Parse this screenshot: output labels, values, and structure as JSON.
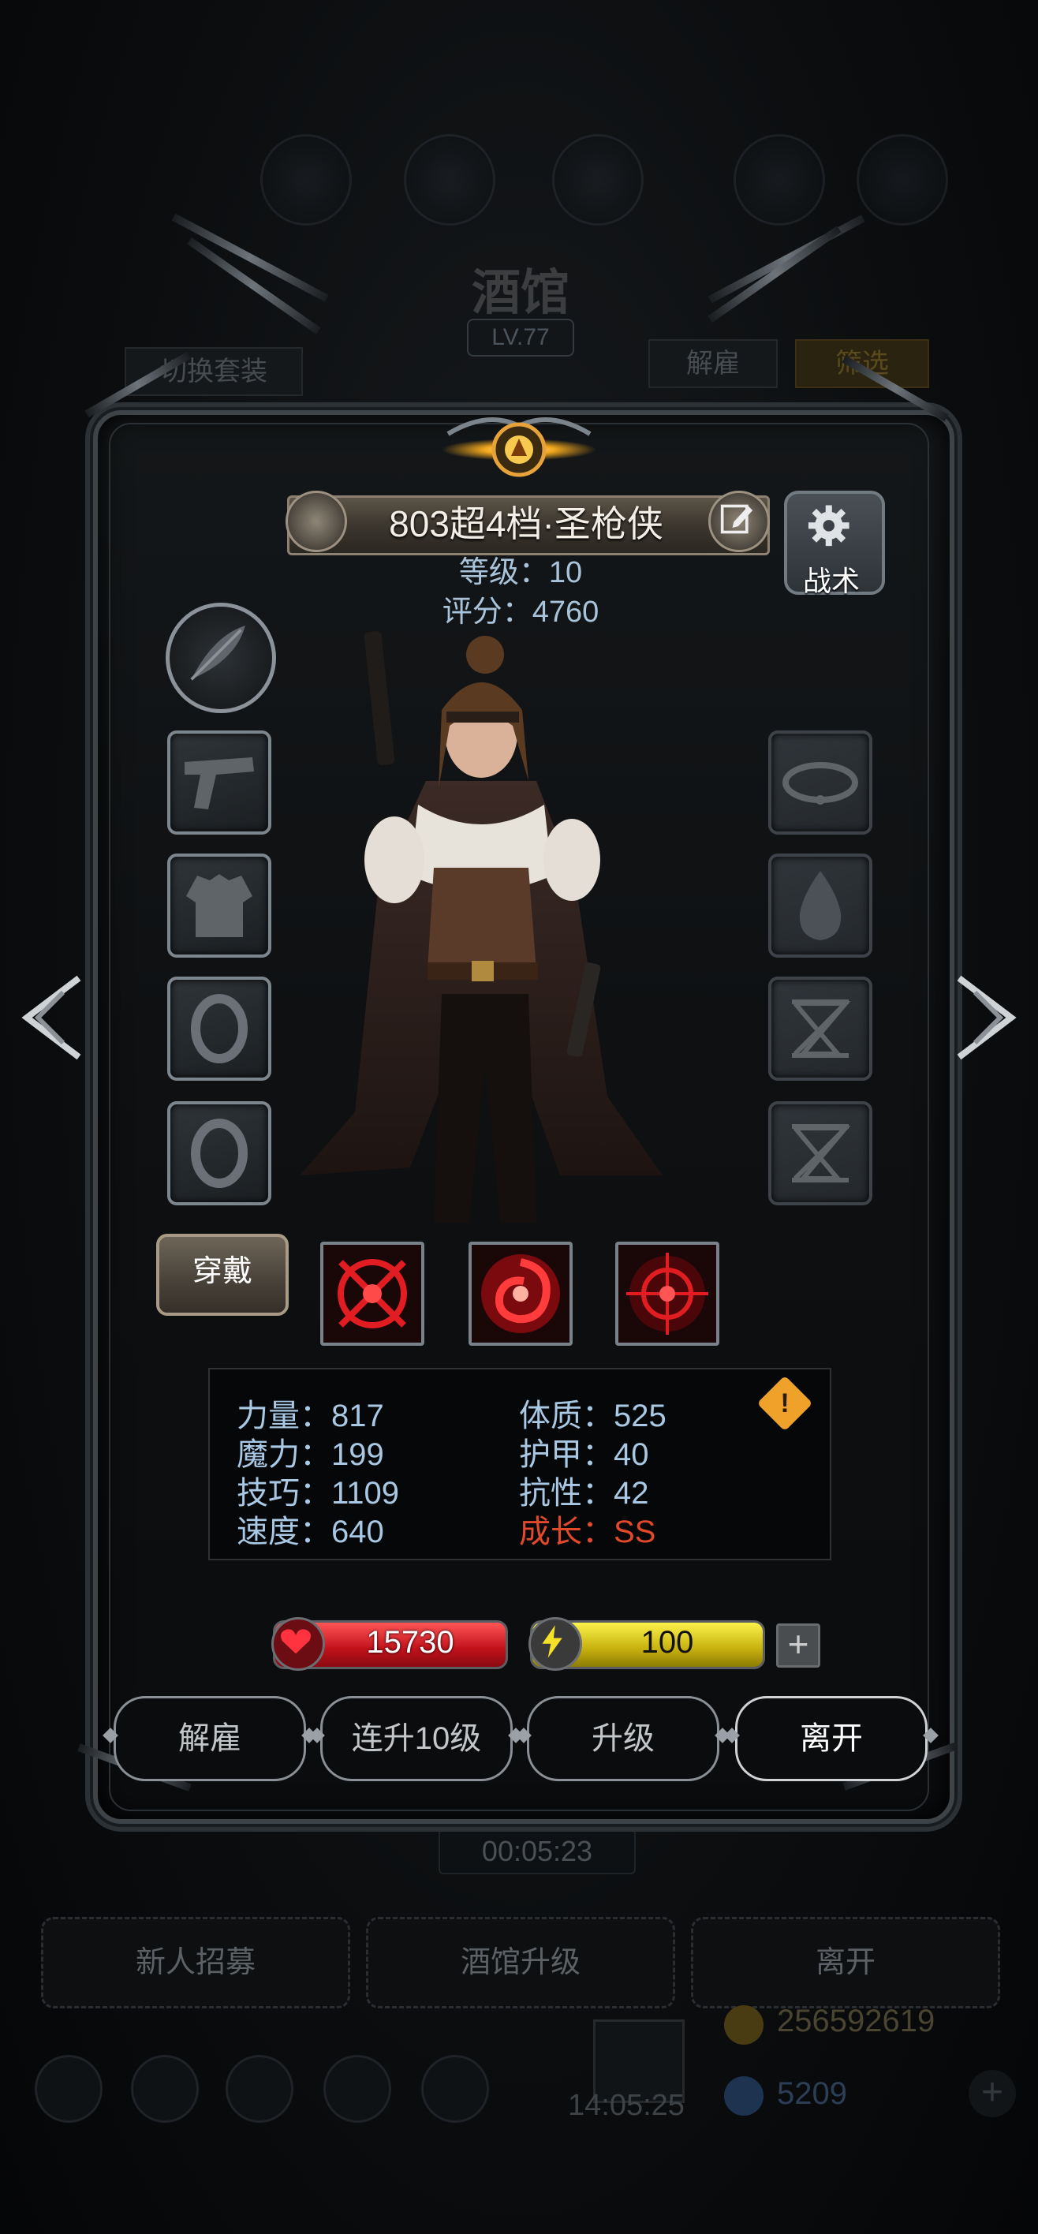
{
  "background": {
    "title": "酒馆",
    "level": "LV.77",
    "switch_outfit_label": "切换套装",
    "dismiss_label": "解雇",
    "filter_label": "筛选",
    "timer": "00:05:23",
    "bottom_buttons": [
      "新人招募",
      "酒馆升级",
      "离开"
    ],
    "clock": "14:05:25",
    "gold": "256592619",
    "gems": "5209"
  },
  "hero": {
    "name": "803超4档·圣枪侠",
    "level_text": "等级：10",
    "score_text": "评分：4760",
    "tactic_label": "战术"
  },
  "equipment": {
    "left_slots": [
      "feather-icon",
      "pistol-icon",
      "armor-icon",
      "ring-icon",
      "ring-icon"
    ],
    "right_slots": [
      "bracelet-icon",
      "flame-icon",
      "hourglass-icon",
      "hourglass-icon"
    ],
    "wear_label": "穿戴",
    "skills": [
      "crosshair-skill-icon",
      "vortex-skill-icon",
      "target-skill-icon"
    ]
  },
  "stats": {
    "strength": "力量：817",
    "magic": "魔力：199",
    "skill": "技巧：1109",
    "speed": "速度：640",
    "constitution": "体质：525",
    "armor": "护甲：40",
    "resistance": "抗性：42",
    "growth": "成长：SS"
  },
  "resources": {
    "hp": "15730",
    "energy": "100"
  },
  "actions": [
    "解雇",
    "连升10级",
    "升级",
    "离开"
  ],
  "colors": {
    "stat_text": "#a8c8e4",
    "growth": "#e2492a",
    "hp_bar": "#c0111b",
    "energy_bar": "#c6b00e",
    "warning": "#f0a129"
  }
}
